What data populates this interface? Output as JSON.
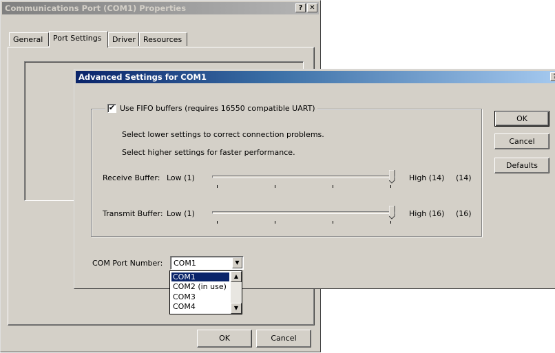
{
  "back_window": {
    "title": "Communications Port (COM1) Properties",
    "help_btn": "?",
    "close_btn": "✕",
    "tabs": [
      {
        "label": "General"
      },
      {
        "label": "Port Settings"
      },
      {
        "label": "Driver"
      },
      {
        "label": "Resources"
      }
    ],
    "ok_label": "OK",
    "cancel_label": "Cancel"
  },
  "dialog": {
    "title": "Advanced Settings for COM1",
    "help_btn": "?",
    "close_btn": "✕",
    "fifo_checkbox": {
      "label": "Use FIFO buffers (requires 16550 compatible UART)",
      "checked": true,
      "mark": "✔"
    },
    "hint_lower": "Select lower settings to correct connection problems.",
    "hint_higher": "Select higher settings for faster performance.",
    "receive": {
      "label": "Receive Buffer:",
      "low": "Low (1)",
      "high": "High (14)",
      "value": "(14)",
      "level": 1.0
    },
    "transmit": {
      "label": "Transmit Buffer:",
      "low": "Low (1)",
      "high": "High (16)",
      "value": "(16)",
      "level": 1.0
    },
    "com_port": {
      "label": "COM Port Number:",
      "selected": "COM1",
      "options": [
        "COM1",
        "COM2 (in use)",
        "COM3",
        "COM4"
      ]
    },
    "buttons": {
      "ok": "OK",
      "cancel": "Cancel",
      "defaults": "Defaults"
    }
  },
  "icons": {
    "dropdown_arrow": "▼",
    "scroll_up": "▲",
    "scroll_down": "▼"
  }
}
